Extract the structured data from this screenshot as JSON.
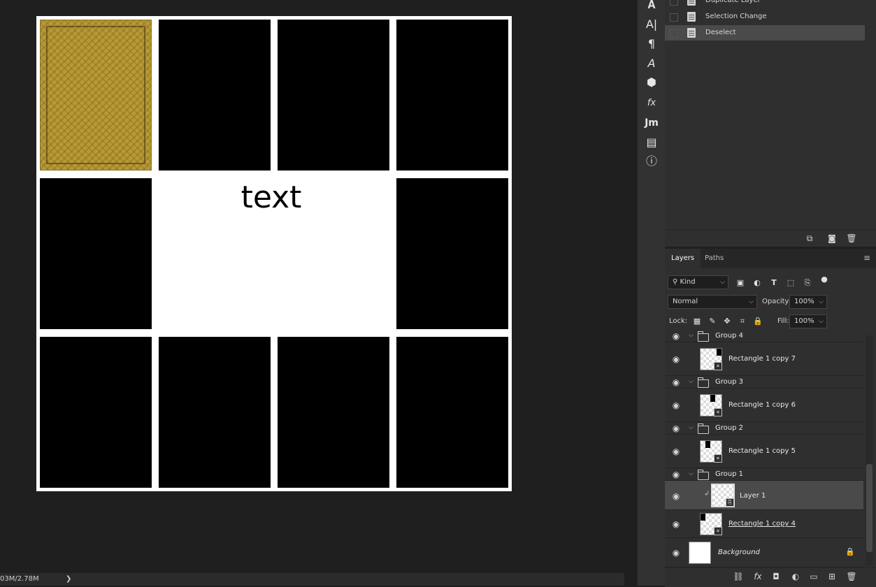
{
  "canvas": {
    "text": "text"
  },
  "status_bar": {
    "doc_size": "03M/2.78M",
    "arrow": "❯"
  },
  "history": {
    "items": [
      {
        "label": "Duplicate Layer",
        "selected": false
      },
      {
        "label": "Selection Change",
        "selected": false
      },
      {
        "label": "Deselect",
        "selected": true
      }
    ]
  },
  "tools": {
    "icons": [
      "character-style-icon",
      "text-cursor-icon",
      "paragraph-icon",
      "glyphs-icon",
      "3d-icon",
      "styles-icon",
      "jm-icon",
      "notes-icon",
      "info-icon"
    ],
    "jm_label": "Jm"
  },
  "layers_panel": {
    "tabs": [
      {
        "label": "Layers",
        "active": true
      },
      {
        "label": "Paths",
        "active": false
      }
    ],
    "filter": {
      "kind_label": "Kind"
    },
    "blend_mode": "Normal",
    "opacity_label": "Opacity:",
    "opacity_value": "100%",
    "lock_label": "Lock:",
    "fill_label": "Fill:",
    "fill_value": "100%",
    "layers": [
      {
        "name": "Group 4",
        "type": "group"
      },
      {
        "name": "Rectangle 1 copy 7",
        "type": "shape"
      },
      {
        "name": "Group 3",
        "type": "group"
      },
      {
        "name": "Rectangle 1 copy 6",
        "type": "shape"
      },
      {
        "name": "Group 2",
        "type": "group"
      },
      {
        "name": "Rectangle 1 copy 5",
        "type": "shape"
      },
      {
        "name": "Group 1",
        "type": "group"
      },
      {
        "name": "Layer 1",
        "type": "smart-object",
        "selected": true
      },
      {
        "name": "Rectangle 1 copy 4",
        "type": "shape"
      },
      {
        "name": "Background",
        "type": "background",
        "locked": true
      }
    ]
  },
  "colors": {
    "app_bg": "#1f1f1f",
    "panel_bg": "#2f2f2f",
    "selected_row": "#4a4a4a",
    "rug_gold": "#b89a35"
  }
}
